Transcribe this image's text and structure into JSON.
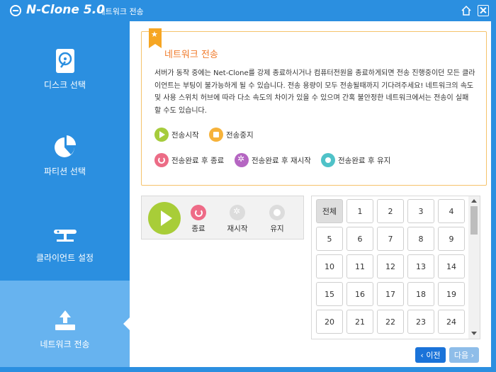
{
  "app": {
    "title": "N-Clone 5.0",
    "subtitle": "- 네트워크 전송"
  },
  "sidebar": {
    "items": [
      {
        "label": "디스크 선택",
        "icon": "disk-icon"
      },
      {
        "label": "파티션 선택",
        "icon": "pie-chart-icon"
      },
      {
        "label": "클라이언트 설정",
        "icon": "network-icon"
      },
      {
        "label": "네트워크 전송",
        "icon": "upload-icon"
      }
    ],
    "active_index": 3
  },
  "info": {
    "title": "네트워크 전송",
    "body": "서버가 동작 중에는 Net-Clone를 강제 종료하시거나 컴퓨터전원을 종료하게되면 전송 진행중이던 모든 클라이언트는 부팅이 불가능하게 될 수 있습니다. 전송 용량이 모두 전송될때까지 기다려주세요! 네트워크의 속도 및 사용 스위치 허브에 따라 다소 속도의 차이가 있을 수 있으며 간혹 불안정한 네트워크에서는 전송이 실패 할 수도 있습니다.",
    "legend": [
      {
        "label": "전송시작",
        "icon": "play-icon",
        "color": "#a6cc3c"
      },
      {
        "label": "전송중지",
        "icon": "stop-icon",
        "color": "#f6b23a"
      },
      {
        "label": "전송완료 후 종료",
        "icon": "power-icon",
        "color": "#ec6c86"
      },
      {
        "label": "전송완료 후 재시작",
        "icon": "restart-icon",
        "color": "#b566c2"
      },
      {
        "label": "전송완료 후 유지",
        "icon": "keep-icon",
        "color": "#4fc2c8"
      }
    ]
  },
  "controls": {
    "shutdown_label": "종료",
    "restart_label": "재시작",
    "keep_label": "유지"
  },
  "clients": {
    "all_label": "전체",
    "numbers": [
      "1",
      "2",
      "3",
      "4",
      "5",
      "6",
      "7",
      "8",
      "9",
      "10",
      "11",
      "12",
      "13",
      "14",
      "15",
      "16",
      "17",
      "18",
      "19",
      "20",
      "21",
      "22",
      "23",
      "24"
    ]
  },
  "nav": {
    "prev_label": "‹ 이전",
    "next_label": "다음 ›"
  }
}
